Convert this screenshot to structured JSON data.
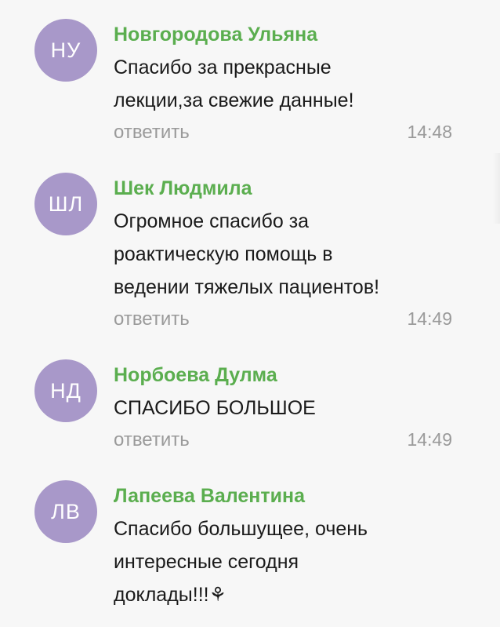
{
  "comments": [
    {
      "initials": "НУ",
      "author": "Новгородова Ульяна",
      "text": "Спасибо за прекрасные\nлекции,за свежие данные!",
      "reply_label": "ответить",
      "time": "14:48"
    },
    {
      "initials": "ШЛ",
      "author": "Шек Людмила",
      "text": "Огромное спасибо за\npoактическую помощь в\nведении тяжелых пациентов!",
      "reply_label": "ответить",
      "time": "14:49"
    },
    {
      "initials": "НД",
      "author": "Норбоева Дулма",
      "text": "СПАСИБО БОЛЬШОЕ",
      "reply_label": "ответить",
      "time": "14:49"
    },
    {
      "initials": "ЛВ",
      "author": "Лапеева Валентина",
      "text": "Спасибо большущее, очень\nинтересные сегодня\nдоклады!!!⚘",
      "reply_label": "",
      "time": ""
    }
  ],
  "colors": {
    "avatar_bg": "#a898c9",
    "author_name": "#5bae4f",
    "muted_text": "#9a9a9a",
    "background": "#f7f7f7"
  }
}
